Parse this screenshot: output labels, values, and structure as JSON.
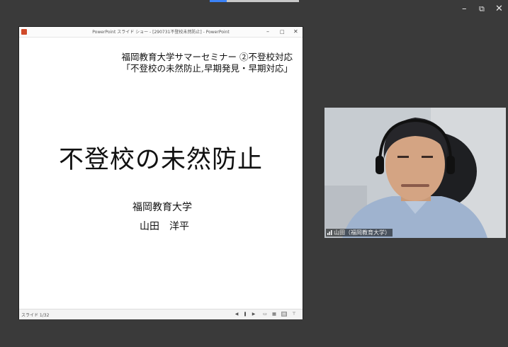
{
  "window": {
    "controls": {
      "minimize": "–",
      "restore": "⧉",
      "close": "✕"
    }
  },
  "ppt_window": {
    "title": "PowerPoint スライド ショー - [290731不登校未然防止] - PowerPoint",
    "controls": {
      "minimize": "–",
      "maximize": "□",
      "close": "✕"
    },
    "status": {
      "slide_counter": "スライド 1/32",
      "icons": [
        "prev-icon",
        "pause-icon",
        "next-icon",
        "normal-view-icon",
        "slide-sorter-icon",
        "reading-view-icon",
        "slideshow-icon"
      ],
      "active_view": "reading-view-icon"
    }
  },
  "slide": {
    "seminar_line1": "福岡教育大学サマーセミナー ②不登校対応",
    "seminar_line2": "「不登校の未然防止,早期発見・早期対応」",
    "title": "不登校の未然防止",
    "university": "福岡教育大学",
    "presenter": "山田　洋平"
  },
  "participant": {
    "name_label": "山田（福岡教育大学）"
  },
  "colors": {
    "background": "#3a3a3a",
    "powerpoint_red": "#d04a2a",
    "tab_accent": "#3b82f6"
  }
}
